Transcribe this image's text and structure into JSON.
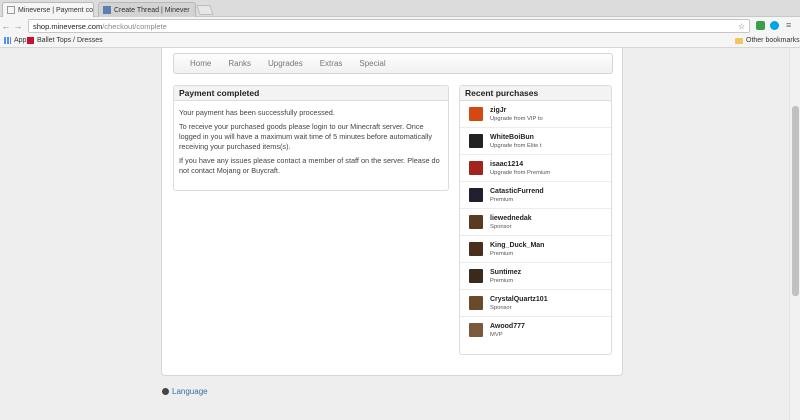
{
  "browser": {
    "tabs": [
      {
        "title": "Mineverse | Payment co",
        "active": true
      },
      {
        "title": "Create Thread | Minever",
        "active": false
      }
    ],
    "url_host": "shop.mineverse.com",
    "url_path": "/checkout/complete",
    "bookmarks": [
      {
        "label": "Apps"
      },
      {
        "label": "Ballet Tops / Dresses"
      }
    ],
    "other_bookmarks": "Other bookmarks"
  },
  "nav": {
    "items": [
      "Home",
      "Ranks",
      "Upgrades",
      "Extras",
      "Special"
    ]
  },
  "payment": {
    "title": "Payment completed",
    "paragraphs": [
      "Your payment has been successfully processed.",
      "To receive your purchased goods please login to our Minecraft server. Once logged in you will have a maximum wait time of 5 minutes before automatically receiving your purchased items(s).",
      "If you have any issues please contact a member of staff on the server. Please do not contact Mojang or Buycraft."
    ]
  },
  "recent": {
    "title": "Recent purchases",
    "items": [
      {
        "name": "zigJr",
        "desc": "Upgrade from VIP to",
        "color": "#d24a12"
      },
      {
        "name": "WhiteBoiBun",
        "desc": "Upgrade from Elite t",
        "color": "#222222"
      },
      {
        "name": "isaac1214",
        "desc": "Upgrade from Premium",
        "color": "#a3231e"
      },
      {
        "name": "CatasticFurrend",
        "desc": "Premium",
        "color": "#1f1f2e"
      },
      {
        "name": "liewednedak",
        "desc": "Sponsor",
        "color": "#5b3a22"
      },
      {
        "name": "King_Duck_Man",
        "desc": "Premium",
        "color": "#4a2f1d"
      },
      {
        "name": "Suntimez",
        "desc": "Premium",
        "color": "#3a2a1c"
      },
      {
        "name": "CrystalQuartz101",
        "desc": "Sponsor",
        "color": "#6b4a2a"
      },
      {
        "name": "Awood777",
        "desc": "MVP",
        "color": "#7a5a3a"
      }
    ]
  },
  "footer": {
    "language": "Language"
  },
  "colors": {
    "link": "#3b6ea5",
    "accent": "#dcdcdc"
  }
}
